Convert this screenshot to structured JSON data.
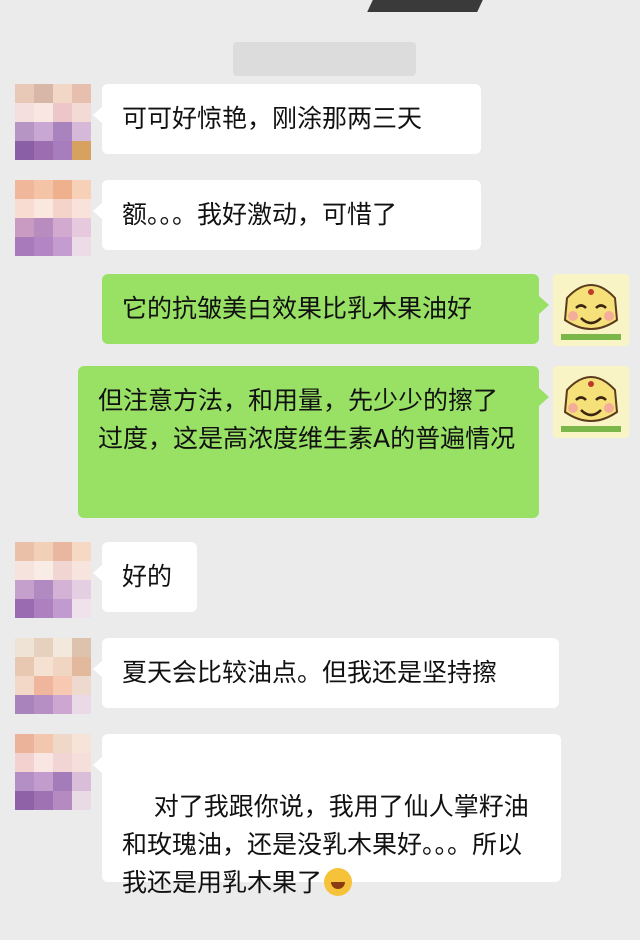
{
  "status_bar": {
    "time": ""
  },
  "messages": [
    {
      "side": "in",
      "text": "可可好惊艳，刚涂那两三天"
    },
    {
      "side": "in",
      "text": "额。。。我好激动，可惜了"
    },
    {
      "side": "out",
      "text": "它的抗皱美白效果比乳木果油好"
    },
    {
      "side": "out",
      "text": "但注意方法，和用量，先少少的擦了过度，这是高浓度维生素A的普遍情况"
    },
    {
      "side": "in",
      "text": "好的"
    },
    {
      "side": "in",
      "text": "夏天会比较油点。但我还是坚持擦"
    },
    {
      "side": "in",
      "text": "对了我跟你说，我用了仙人掌籽油和玫瑰油，还是没乳木果好。。。所以我还是用乳木果了",
      "emoji": "laughing-crying-emoji"
    }
  ],
  "colors": {
    "background": "#ebebeb",
    "incoming_bubble": "#ffffff",
    "outgoing_bubble": "#98e165"
  }
}
